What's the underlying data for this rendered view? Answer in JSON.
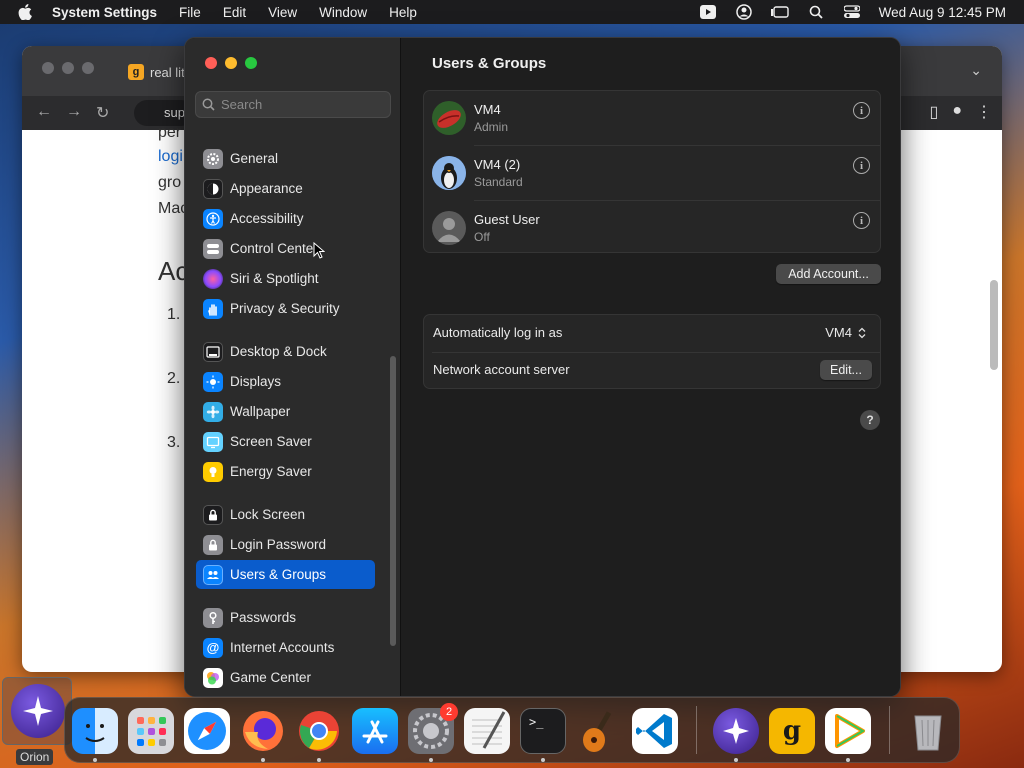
{
  "menubar": {
    "app_name": "System Settings",
    "menus": [
      "File",
      "Edit",
      "View",
      "Window",
      "Help"
    ],
    "datetime": "Wed Aug 9  12:45 PM"
  },
  "browser": {
    "tab_title": "real lit",
    "favicon": "g",
    "url": "sup",
    "page_lines": [
      "per",
      "logi",
      "gro",
      "Mac"
    ],
    "heading": "Ac",
    "list_numbers": [
      "1.",
      "2.",
      "3."
    ]
  },
  "sidebar": {
    "search_placeholder": "Search",
    "items": [
      {
        "label": "General",
        "icon": "gear-icon",
        "color": "#8e8e93"
      },
      {
        "label": "Appearance",
        "icon": "appearance-icon",
        "color": "#1c1c1e"
      },
      {
        "label": "Accessibility",
        "icon": "accessibility-icon",
        "color": "#0a84ff"
      },
      {
        "label": "Control Center",
        "icon": "control-center-icon",
        "color": "#8e8e93"
      },
      {
        "label": "Siri & Spotlight",
        "icon": "siri-icon",
        "color": "#b04ad8"
      },
      {
        "label": "Privacy & Security",
        "icon": "hand-icon",
        "color": "#0a84ff"
      },
      {
        "label": "Desktop & Dock",
        "icon": "dock-icon",
        "color": "#1c1c1e"
      },
      {
        "label": "Displays",
        "icon": "sun-icon",
        "color": "#0a84ff"
      },
      {
        "label": "Wallpaper",
        "icon": "wallpaper-icon",
        "color": "#32ade6"
      },
      {
        "label": "Screen Saver",
        "icon": "screen-saver-icon",
        "color": "#64d2ff"
      },
      {
        "label": "Energy Saver",
        "icon": "lightbulb-icon",
        "color": "#ffcc00"
      },
      {
        "label": "Lock Screen",
        "icon": "lock-icon",
        "color": "#1c1c1e"
      },
      {
        "label": "Login Password",
        "icon": "padlock-icon",
        "color": "#8e8e93"
      },
      {
        "label": "Users & Groups",
        "icon": "users-icon",
        "color": "#0a84ff"
      },
      {
        "label": "Passwords",
        "icon": "key-icon",
        "color": "#8e8e93"
      },
      {
        "label": "Internet Accounts",
        "icon": "at-icon",
        "color": "#0a84ff"
      },
      {
        "label": "Game Center",
        "icon": "game-center-icon",
        "color": "#ffffff"
      }
    ],
    "selected": "Users & Groups"
  },
  "content": {
    "title": "Users & Groups",
    "users": [
      {
        "name": "VM4",
        "role": "Admin",
        "avatar": "lips-avatar"
      },
      {
        "name": "VM4 (2)",
        "role": "Standard",
        "avatar": "penguin-avatar"
      },
      {
        "name": "Guest User",
        "role": "Off",
        "avatar": "generic-person-avatar"
      }
    ],
    "add_account_label": "Add Account...",
    "auto_login_label": "Automatically log in as",
    "auto_login_value": "VM4",
    "network_server_label": "Network account server",
    "edit_label": "Edit...",
    "help_label": "?"
  },
  "dock": {
    "orion_label": "Orion",
    "apps": [
      "Finder",
      "Launchpad",
      "Safari",
      "Firefox",
      "Chrome",
      "App Store",
      "System Settings",
      "TextEdit",
      "Terminal",
      "GarageBand",
      "VS Code",
      "Orion",
      "Grammarly",
      "Infuse",
      "Trash"
    ],
    "settings_badge": "2"
  }
}
